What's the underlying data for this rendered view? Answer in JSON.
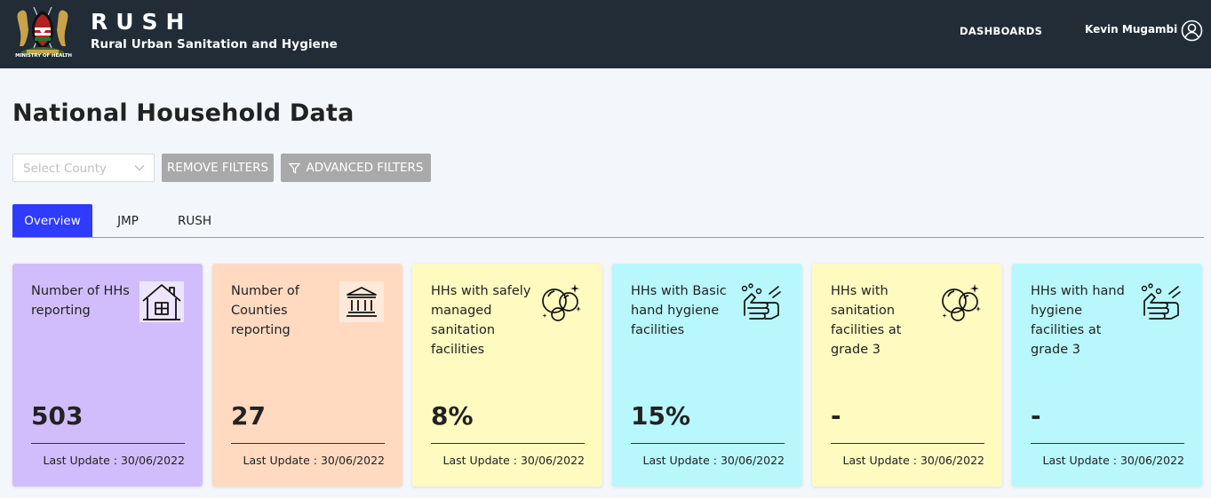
{
  "header": {
    "logo_caption": "MINISTRY OF HEALTH",
    "brand_title": "RUSH",
    "brand_subtitle": "Rural Urban Sanitation and Hygiene",
    "nav_dashboards": "DASHBOARDS",
    "user_name": "Kevin Mugambi"
  },
  "page": {
    "title": "National Household Data"
  },
  "filters": {
    "county_placeholder": "Select County",
    "remove_filters": "REMOVE FILTERS",
    "advanced_filters": "ADVANCED FILTERS"
  },
  "tabs": [
    {
      "label": "Overview",
      "active": true
    },
    {
      "label": "JMP",
      "active": false
    },
    {
      "label": "RUSH",
      "active": false
    }
  ],
  "cards": [
    {
      "label": "Number of HHs reporting",
      "value": "503",
      "update_label": "Last Update :",
      "update_date": "30/06/2022",
      "color": "#d1bdfb",
      "icon": "house-icon"
    },
    {
      "label": "Number of Counties reporting",
      "value": "27",
      "update_label": "Last Update :",
      "update_date": "30/06/2022",
      "color": "#ffdac1",
      "icon": "government-building-icon"
    },
    {
      "label": "HHs with safely managed sanitation facilities",
      "value": "8%",
      "update_label": "Last Update :",
      "update_date": "30/06/2022",
      "color": "#fffac0",
      "icon": "soap-bubbles-icon"
    },
    {
      "label": "HHs with Basic hand hygiene facilities",
      "value": "15%",
      "update_label": "Last Update :",
      "update_date": "30/06/2022",
      "color": "#b8f8fd",
      "icon": "hand-washing-icon"
    },
    {
      "label": "HHs with sanitation facilities at grade 3",
      "value": "-",
      "update_label": "Last Update :",
      "update_date": "30/06/2022",
      "color": "#fffac0",
      "icon": "soap-bubbles-icon"
    },
    {
      "label": "HHs with hand hygiene facilities at grade 3",
      "value": "-",
      "update_label": "Last Update :",
      "update_date": "30/06/2022",
      "color": "#b8f8fd",
      "icon": "hand-washing-icon"
    }
  ],
  "colors": {
    "header_bg": "#212c37",
    "tab_active": "#2f3bff",
    "button_grey": "#a9a9a9"
  }
}
